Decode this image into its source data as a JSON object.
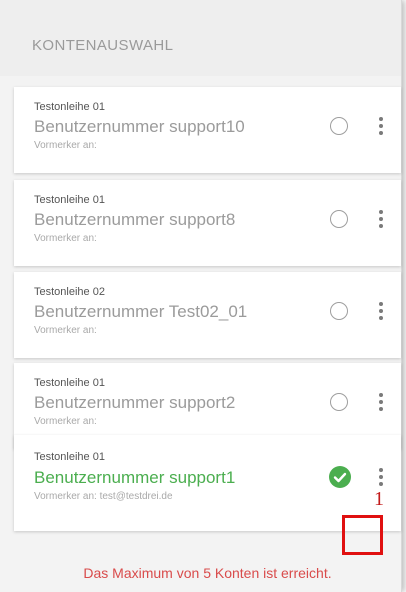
{
  "header": {
    "title": "KONTENAUSWAHL"
  },
  "accounts": [
    {
      "library": "Testonleihe 01",
      "user": "Benutzernummer support10",
      "vormerker": "Vormerker an:",
      "selected": false
    },
    {
      "library": "Testonleihe 01",
      "user": "Benutzernummer support8",
      "vormerker": "Vormerker an:",
      "selected": false
    },
    {
      "library": "Testonleihe 02",
      "user": "Benutzernummer Test02_01",
      "vormerker": "Vormerker an:",
      "selected": false
    },
    {
      "library": "Testonleihe 01",
      "user": "Benutzernummer support2",
      "vormerker": "Vormerker an:",
      "selected": false
    },
    {
      "library": "Testonleihe 01",
      "user": "Benutzernummer support1",
      "vormerker": "Vormerker an: test@testdrei.de",
      "selected": true
    }
  ],
  "footer": {
    "message": "Das Maximum von 5 Konten ist erreicht."
  },
  "annotation": {
    "label": "1"
  },
  "colors": {
    "active_green": "#4bae4f",
    "warning_red": "#d94b4b",
    "annotation_red": "#e01010"
  },
  "icons": {
    "selected": "check-circle-icon",
    "unselected": "radio-circle-icon",
    "menu": "more-vert-icon"
  }
}
